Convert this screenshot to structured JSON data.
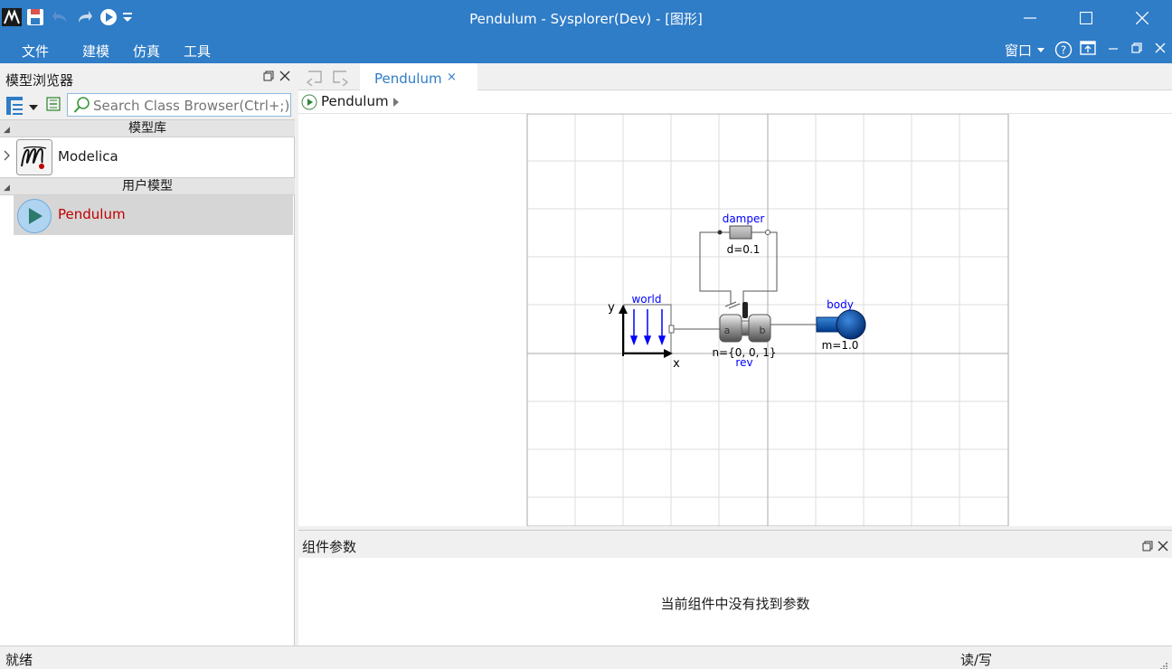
{
  "window": {
    "title": "Pendulum - Sysplorer(Dev) - [图形]"
  },
  "menu": {
    "items": [
      "文件",
      "建模",
      "仿真",
      "工具"
    ],
    "window_label": "窗口"
  },
  "model_browser": {
    "title": "模型浏览器",
    "search_placeholder": "Search Class Browser(Ctrl+;)",
    "sections": {
      "library": "模型库",
      "user": "用户模型"
    },
    "libraries": [
      {
        "name": "Modelica"
      }
    ],
    "user_models": [
      {
        "name": "Pendulum",
        "color": "#c00000"
      }
    ]
  },
  "editor": {
    "tab": {
      "label": "Pendulum",
      "close": "×"
    },
    "breadcrumb": "Pendulum"
  },
  "diagram": {
    "components": {
      "world": {
        "name": "world",
        "x_label": "x",
        "y_label": "y"
      },
      "damper": {
        "name": "damper",
        "param": "d=0.1"
      },
      "rev": {
        "name": "rev",
        "param": "n={0, 0, 1}",
        "port_a": "a",
        "port_b": "b"
      },
      "body": {
        "name": "body",
        "param": "m=1.0"
      }
    },
    "name_color": "#0000ff"
  },
  "params_panel": {
    "title": "组件参数",
    "empty_message": "当前组件中没有找到参数"
  },
  "statusbar": {
    "left": "就绪",
    "right": "读/写"
  },
  "colors": {
    "accent": "#2f7cc7",
    "title_text": "#ffffff"
  }
}
